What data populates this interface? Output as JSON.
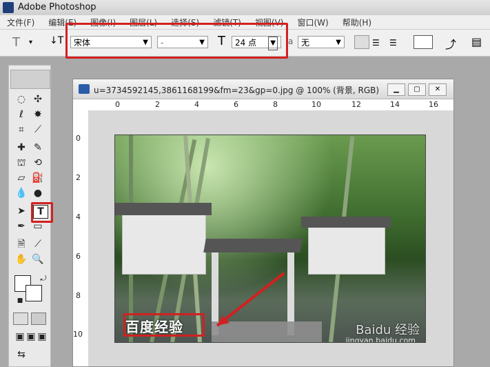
{
  "app": {
    "title": "Adobe Photoshop"
  },
  "menu": [
    "文件(F)",
    "编辑(E)",
    "图像(I)",
    "图层(L)",
    "选择(S)",
    "滤镜(T)",
    "视图(V)",
    "窗口(W)",
    "帮助(H)"
  ],
  "options": {
    "tool_letter": "T",
    "font_family": "宋体",
    "font_style": "-",
    "size_icon": "T",
    "font_size": "24 点",
    "aa_prefix": "a",
    "anti_alias": "无"
  },
  "document": {
    "title": "u=3734592145,3861168199&fm=23&gp=0.jpg @ 100% (背景, RGB)",
    "ruler_h": [
      "0",
      "2",
      "4",
      "6",
      "8",
      "10",
      "12",
      "14",
      "16"
    ],
    "ruler_v": [
      "0",
      "2",
      "4",
      "6",
      "8",
      "10"
    ],
    "image_text": "百度经验",
    "watermark": "Baidu 经验",
    "watermark_sub": "jingyan.baidu.com"
  },
  "colors": {
    "highlight": "#d32020"
  }
}
